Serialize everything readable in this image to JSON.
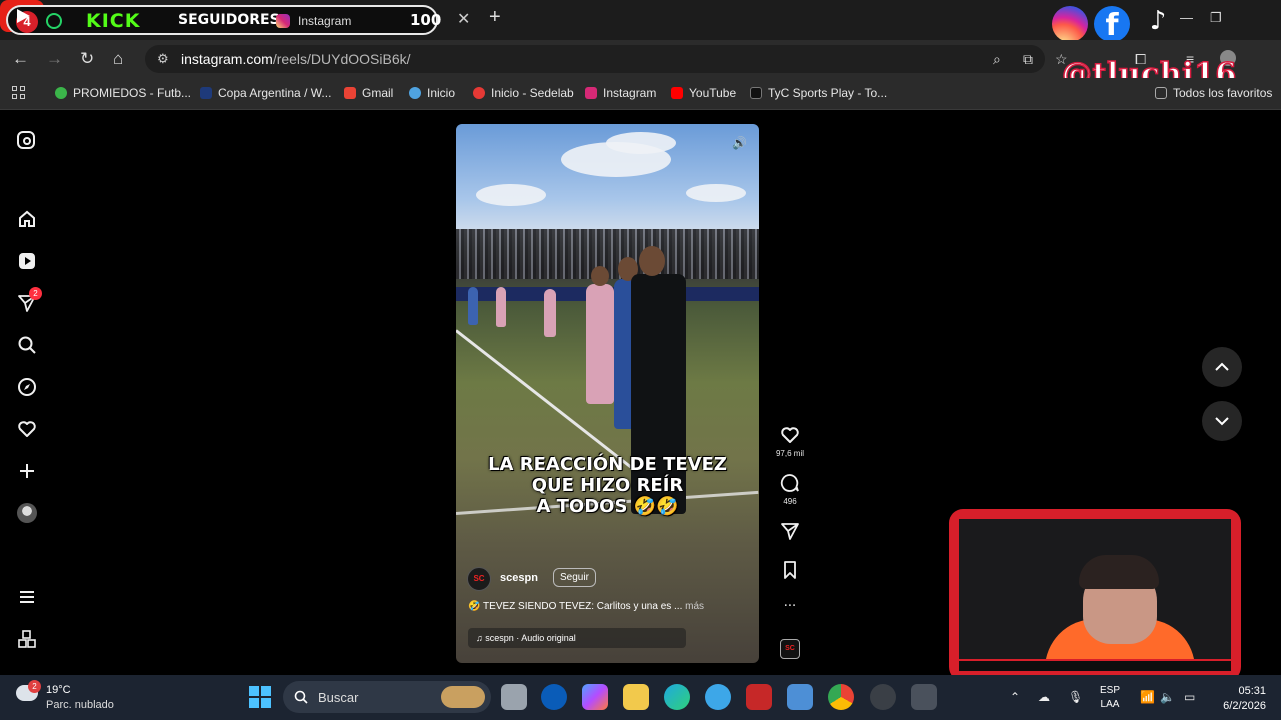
{
  "tab": {
    "kick_badge": "4",
    "kick_logo": "KICK",
    "overlay_label": "SEGUIDORES",
    "title": "Instagram",
    "follower_count": "100",
    "close": "✕",
    "new_tab": "+"
  },
  "overlay": {
    "handle": "@tluchi16",
    "facebook_letter": "f",
    "tiktok_glyph": "♪"
  },
  "toolbar": {
    "url_host": "instagram.com",
    "url_path": "/reels/DUYdOOSiB6k/"
  },
  "bookmarks": [
    {
      "label": "PROMIEDOS - Futb...",
      "color": "#3bb54a"
    },
    {
      "label": "Copa Argentina / W...",
      "color": "#1e3a7a"
    },
    {
      "label": "Gmail",
      "color": "#ea4335"
    },
    {
      "label": "Inicio",
      "color": "#4fa3e0"
    },
    {
      "label": "Inicio - Sedelab",
      "color": "#e53935"
    },
    {
      "label": "Instagram",
      "color": "#d62976"
    },
    {
      "label": "YouTube",
      "color": "#ff0000"
    },
    {
      "label": "TyC Sports Play - To...",
      "color": "#111111"
    },
    {
      "label": "Todos los favoritos",
      "color": "#555555"
    }
  ],
  "nav": {
    "notifications_badge": "2"
  },
  "reel": {
    "caption_lines": [
      "LA REACCIÓN DE TEVEZ",
      "QUE HIZO REÍR",
      "A TODOS 🤣🤣"
    ],
    "author": "scespn",
    "avatar_text": "SC",
    "follow_label": "Seguir",
    "description": "🤣 TEVEZ SIENDO TEVEZ: Carlitos y una es ...",
    "more_label": "más",
    "audio": "♫ scespn · Audio original",
    "likes": "97,6 mil",
    "comments": "496",
    "more_actions": "···",
    "audio_thumb": "SC"
  },
  "taskbar": {
    "weather_badge": "2",
    "temperature": "19°C",
    "weather_desc": "Parc. nublado",
    "search_label": "Buscar",
    "lang_top": "ESP",
    "lang_bottom": "LAA",
    "time": "05:31",
    "date": "6/2/2026"
  }
}
